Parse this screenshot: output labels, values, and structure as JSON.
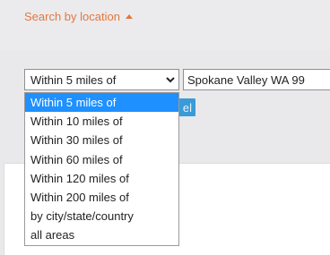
{
  "search_toggle": {
    "label": "Search by location",
    "icon": "caret-up-icon",
    "color": "#e3773f"
  },
  "radius_select": {
    "selected": "Within 5 miles of",
    "options": [
      "Within 5 miles of",
      "Within 10 miles of",
      "Within 30 miles of",
      "Within 60 miles of",
      "Within 120 miles of",
      "Within 200 miles of",
      "by city/state/country",
      "all areas"
    ],
    "highlighted_index": 0,
    "highlight_color": "#1e90ff"
  },
  "location_input": {
    "value": "Spokane Valley WA 99"
  },
  "search_button": {
    "label": "el",
    "color": "#3a9bd8"
  }
}
